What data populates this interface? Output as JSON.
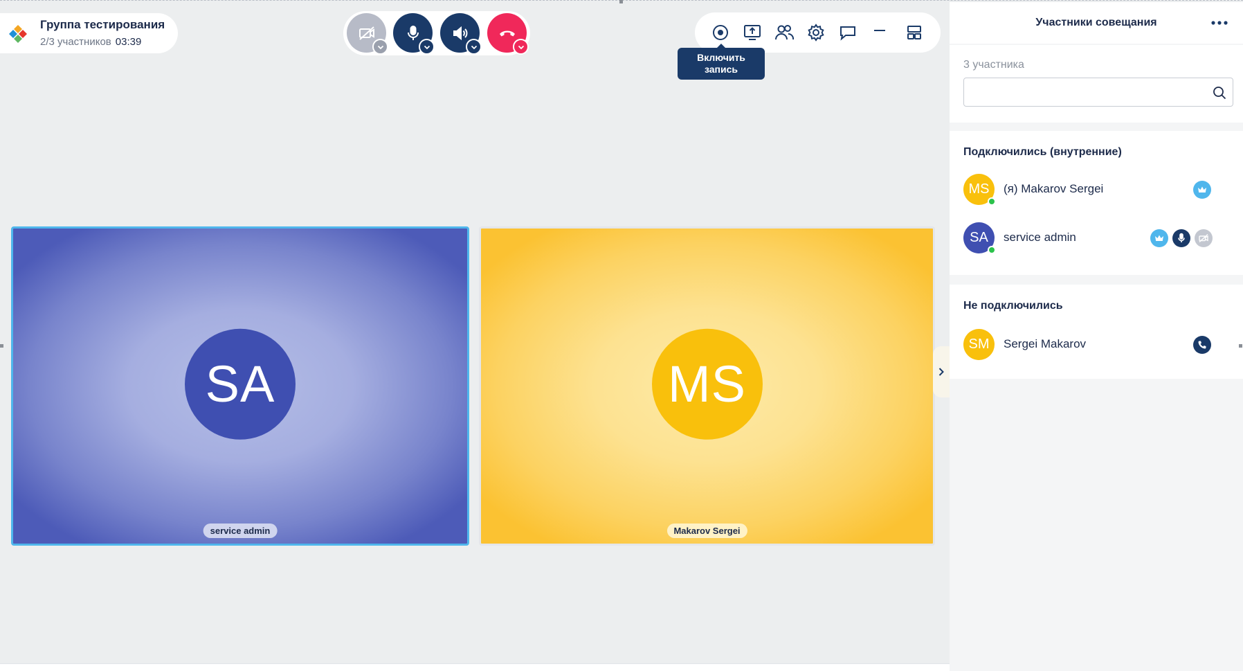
{
  "meeting": {
    "title": "Группа тестирования",
    "participants_count": "2/3 участников",
    "timer": "03:39"
  },
  "controls": {
    "camera": "camera-off-icon",
    "microphone": "microphone-icon",
    "speaker": "speaker-icon",
    "end_call": "hang-up-icon"
  },
  "toolbar": {
    "items": [
      "record-icon",
      "share-screen-icon",
      "participants-icon",
      "settings-icon",
      "chat-icon",
      "minimize-icon",
      "layout-icon"
    ],
    "tooltip": "Включить запись"
  },
  "tiles": [
    {
      "initials": "SA",
      "name": "service admin",
      "color": "#3f4fb1"
    },
    {
      "initials": "MS",
      "name": "Makarov Sergei",
      "color": "#f9c00c"
    }
  ],
  "panel": {
    "title": "Участники совещания",
    "count_label": "3 участника",
    "search_placeholder": "",
    "joined_title": "Подключились (внутренние)",
    "not_joined_title": "Не подключились",
    "joined": [
      {
        "initials": "MS",
        "name": "(я) Makarov Sergei",
        "color": "#f9c00c",
        "online": true,
        "badges": [
          "crown-icon"
        ]
      },
      {
        "initials": "SA",
        "name": "service admin",
        "color": "#3f4fb1",
        "online": true,
        "badges": [
          "crown-icon",
          "microphone-icon",
          "camera-off-icon"
        ]
      }
    ],
    "not_joined": [
      {
        "initials": "SM",
        "name": "Sergei Makarov",
        "color": "#f9c00c",
        "online": false,
        "badges": [
          "phone-icon"
        ]
      }
    ]
  },
  "colors": {
    "accent_dark": "#1a3a68",
    "end_call": "#f0285a",
    "online": "#2bc24b",
    "badge_blue": "#4fb6ec"
  }
}
